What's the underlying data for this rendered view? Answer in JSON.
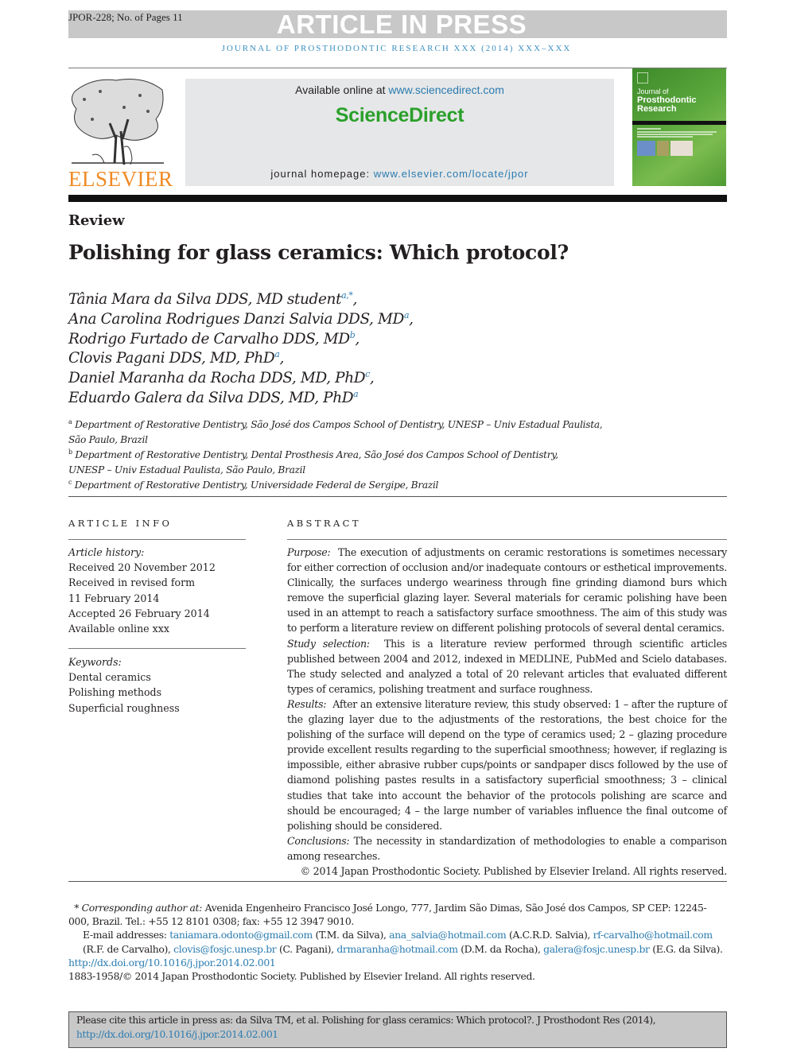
{
  "banner": {
    "meta": "JPOR-228; No. of Pages 11",
    "status": "ARTICLE IN PRESS",
    "journal_running_head": "Journal of Prosthodontic Research xxx (2014) xxx–xxx"
  },
  "masthead": {
    "publisher": "ELSEVIER",
    "available_prefix": "Available online at ",
    "available_link": "www.sciencedirect.com",
    "platform": "ScienceDirect",
    "homepage_prefix": "journal homepage: ",
    "homepage_link": "www.elsevier.com/locate/jpor",
    "cover": {
      "line1": "Journal of",
      "line2": "Prosthodontic",
      "line3": "Research"
    },
    "colors": {
      "publisher_orange": "#f08a24",
      "platform_green": "#2ba02b",
      "link_blue": "#2a7bb0",
      "cover_green": "#5ba83d"
    }
  },
  "article": {
    "type": "Review",
    "title": "Polishing for glass ceramics: Which protocol?",
    "authors": [
      {
        "name": "Tânia Mara da Silva DDS, MD student",
        "aff": "a,*",
        "sep": ","
      },
      {
        "name": "Ana Carolina Rodrigues Danzi Salvia DDS, MD",
        "aff": "a",
        "sep": ","
      },
      {
        "name": "Rodrigo Furtado de Carvalho DDS, MD",
        "aff": "b",
        "sep": ","
      },
      {
        "name": "Clovis Pagani DDS, MD, PhD",
        "aff": "a",
        "sep": ","
      },
      {
        "name": "Daniel Maranha da Rocha DDS, MD, PhD",
        "aff": "c",
        "sep": ","
      },
      {
        "name": "Eduardo Galera da Silva DDS, MD, PhD",
        "aff": "a",
        "sep": ""
      }
    ],
    "affiliations": [
      {
        "key": "a",
        "line1": "Department of Restorative Dentistry, São José dos Campos School of Dentistry, UNESP – Univ Estadual Paulista,",
        "line2": "São Paulo, Brazil"
      },
      {
        "key": "b",
        "line1": "Department of Restorative Dentistry, Dental Prosthesis Area, São José dos Campos School of Dentistry,",
        "line2": "UNESP – Univ Estadual Paulista, São Paulo, Brazil"
      },
      {
        "key": "c",
        "line1": "Department of Restorative Dentistry, Universidade Federal de Sergipe, Brazil",
        "line2": ""
      }
    ]
  },
  "article_info": {
    "heading": "ARTICLE INFO",
    "history_label": "Article history:",
    "history": [
      "Received 20 November 2012",
      "Received in revised form",
      "11 February 2014",
      "Accepted 26 February 2014",
      "Available online xxx"
    ],
    "keywords_label": "Keywords:",
    "keywords": [
      "Dental ceramics",
      "Polishing methods",
      "Superficial roughness"
    ]
  },
  "abstract": {
    "heading": "ABSTRACT",
    "sections": [
      {
        "label": "Purpose:",
        "text": "The execution of adjustments on ceramic restorations is sometimes necessary for either correction of occlusion and/or inadequate contours or esthetical improvements. Clinically, the surfaces undergo weariness through fine grinding diamond burs which remove the superficial glazing layer. Several materials for ceramic polishing have been used in an attempt to reach a satisfactory surface smoothness. The aim of this study was to perform a literature review on different polishing protocols of several dental ceramics."
      },
      {
        "label": "Study selection:",
        "text": "This is a literature review performed through scientific articles published between 2004 and 2012, indexed in MEDLINE, PubMed and Scielo databases. The study selected and analyzed a total of 20 relevant articles that evaluated different types of ceramics, polishing treatment and surface roughness."
      },
      {
        "label": "Results:",
        "text": "After an extensive literature review, this study observed: 1 – after the rupture of the glazing layer due to the adjustments of the restorations, the best choice for the polishing of the surface will depend on the type of ceramics used; 2 – glazing procedure provide excellent results regarding to the superficial smoothness; however, if reglazing is impossible, either abrasive rubber cups/points or sandpaper discs followed by the use of diamond polishing pastes results in a satisfactory superficial smoothness; 3 – clinical studies that take into account the behavior of the protocols polishing are scarce and should be encouraged; 4 – the large number of variables influence the final outcome of polishing should be considered."
      },
      {
        "label": "Conclusions:",
        "text": "The necessity in standardization of methodologies to enable a comparison among researches."
      }
    ],
    "copyright": "© 2014 Japan Prosthodontic Society. Published by Elsevier Ireland. All rights reserved."
  },
  "footnotes": {
    "corresponding_label": "* Corresponding author at:",
    "corresponding_text": "Avenida Engenheiro Francisco José Longo, 777, Jardim São Dimas, São José dos Campos, SP CEP: 12245-000, Brazil. Tel.: +55 12 8101 0308; fax: +55 12 3947 9010.",
    "email_label": "E-mail addresses:",
    "emails": [
      {
        "address": "taniamara.odonto@gmail.com",
        "owner": "(T.M. da Silva),"
      },
      {
        "address": "ana_salvia@hotmail.com",
        "owner": "(A.C.R.D. Salvia),"
      },
      {
        "address": "rf-carvalho@hotmail.com",
        "owner": "(R.F. de Carvalho),"
      },
      {
        "address": "clovis@fosjc.unesp.br",
        "owner": "(C. Pagani),"
      },
      {
        "address": "drmaranha@hotmail.com",
        "owner": "(D.M. da Rocha),"
      },
      {
        "address": "galera@fosjc.unesp.br",
        "owner": "(E.G. da Silva)."
      }
    ],
    "doi": "http://dx.doi.org/10.1016/j.jpor.2014.02.001",
    "issn_line": "1883-1958/© 2014 Japan Prosthodontic Society. Published by Elsevier Ireland. All rights reserved."
  },
  "citation": {
    "text": "Please cite this article in press as: da Silva TM, et al. Polishing for glass ceramics: Which protocol?. J Prosthodont Res (2014), ",
    "link": "http://dx.doi.org/10.1016/j.jpor.2014.02.001"
  }
}
